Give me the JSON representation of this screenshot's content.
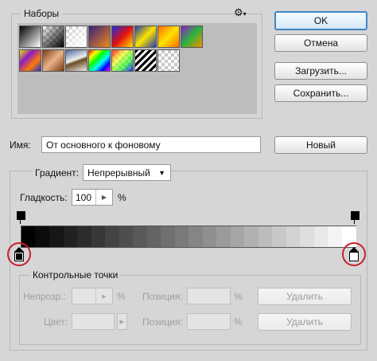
{
  "presets": {
    "legend": "Наборы",
    "menu_icon": "gear-icon",
    "swatches": [
      "black-white",
      "transparent-black",
      "transparent-white",
      "violet-orange",
      "blue-red-yellow",
      "blue-yellow-blue",
      "orange-yellow-orange",
      "violet-green-orange",
      "yellow-violet-orange-blue",
      "copper",
      "chrome",
      "spectrum",
      "transparent-rainbow",
      "transparent-stripes",
      "transparent-checker"
    ]
  },
  "buttons": {
    "ok": "OK",
    "cancel": "Отмена",
    "load": "Загрузить...",
    "save": "Сохранить...",
    "new": "Новый",
    "delete": "Удалить"
  },
  "name": {
    "label": "Имя:",
    "value": "От основного к фоновому"
  },
  "gradient": {
    "type_label": "Градиент:",
    "type_value": "Непрерывный",
    "smoothness_label": "Гладкость:",
    "smoothness_value": "100",
    "percent": "%",
    "colors": [
      "#000000",
      "#ffffff"
    ]
  },
  "stops": {
    "legend": "Контрольные точки",
    "opacity_label": "Непрозр.:",
    "opacity_value": "",
    "color_label": "Цвет:",
    "position_label": "Позиция:",
    "position_value": "",
    "percent": "%"
  }
}
